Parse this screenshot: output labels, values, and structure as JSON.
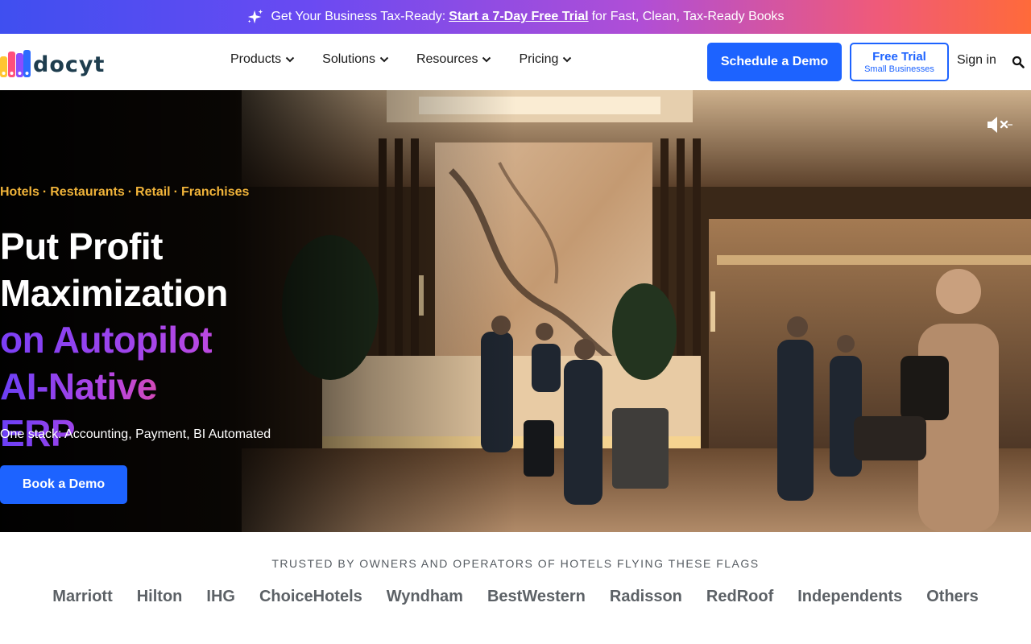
{
  "promo": {
    "icon": "sparkle-icon",
    "prefix": "Get Your Business Tax-Ready:",
    "link": "Start a 7-Day Free Trial",
    "suffix": "for Fast, Clean, Tax-Ready Books",
    "gradient": [
      "#3f4ff0",
      "#b04ed6",
      "#ff6a3a"
    ]
  },
  "nav": {
    "logo_text": "docyt",
    "logo_colors": [
      "#ffc531",
      "#ff4f7b",
      "#8a4dff",
      "#2c6bff"
    ],
    "menu": [
      {
        "label": "Products"
      },
      {
        "label": "Solutions"
      },
      {
        "label": "Resources"
      },
      {
        "label": "Pricing"
      }
    ],
    "schedule_demo": "Schedule a Demo",
    "free_trial": {
      "title": "Free Trial",
      "subtitle": "Small Businesses"
    },
    "sign_in": "Sign in",
    "accent": "#1d63ff"
  },
  "hero": {
    "tags": [
      "Hotels",
      "Restaurants",
      "Retail",
      "Franchises"
    ],
    "tag_separator": "·",
    "headline": {
      "line1": "Put Profit",
      "line2": "Maximization",
      "line3": "on Autopilot",
      "line4": "AI-Native ERP"
    },
    "subtitle": "One stack: Accounting, Payment, BI Automated",
    "cta": "Book a Demo",
    "video_mute_icon": "speaker-muted-icon",
    "tag_color": "#f1b43a"
  },
  "trust": {
    "title": "TRUSTED BY OWNERS AND OPERATORS OF HOTELS FLYING THESE FLAGS",
    "brands": [
      "Marriott",
      "Hilton",
      "IHG",
      "ChoiceHotels",
      "Wyndham",
      "BestWestern",
      "Radisson",
      "RedRoof",
      "Independents",
      "Others"
    ]
  }
}
